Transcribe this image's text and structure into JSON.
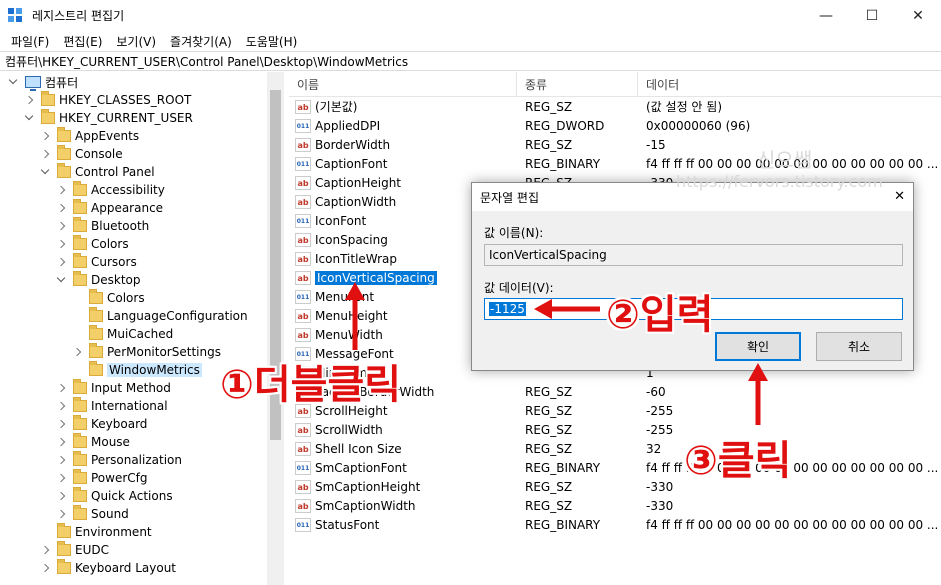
{
  "window": {
    "title": "레지스트리 편집기",
    "controls": {
      "minimize": "—",
      "maximize": "☐",
      "close": "✕"
    }
  },
  "menu": [
    "파일(F)",
    "편집(E)",
    "보기(V)",
    "즐겨찾기(A)",
    "도움말(H)"
  ],
  "address": "컴퓨터\\HKEY_CURRENT_USER\\Control Panel\\Desktop\\WindowMetrics",
  "tree": {
    "computer": "컴퓨터",
    "items": [
      "HKEY_CLASSES_ROOT",
      "HKEY_CURRENT_USER",
      "AppEvents",
      "Console",
      "Control Panel",
      "Accessibility",
      "Appearance",
      "Bluetooth",
      "Colors",
      "Cursors",
      "Desktop",
      "Colors",
      "LanguageConfiguration",
      "MuiCached",
      "PerMonitorSettings",
      "WindowMetrics",
      "Input Method",
      "International",
      "Keyboard",
      "Mouse",
      "Personalization",
      "PowerCfg",
      "Quick Actions",
      "Sound",
      "Environment",
      "EUDC",
      "Keyboard Layout"
    ]
  },
  "list": {
    "columns": [
      "이름",
      "종류",
      "데이터"
    ],
    "rows": [
      {
        "name": "(기본값)",
        "type": "REG_SZ",
        "data": "(값 설정 안 됨)",
        "icon": "ab"
      },
      {
        "name": "AppliedDPI",
        "type": "REG_DWORD",
        "data": "0x00000060 (96)",
        "icon": "bin"
      },
      {
        "name": "BorderWidth",
        "type": "REG_SZ",
        "data": "-15",
        "icon": "ab"
      },
      {
        "name": "CaptionFont",
        "type": "REG_BINARY",
        "data": "f4 ff ff ff 00 00 00 00 00 00 00 00 00 00 00 00 ...",
        "icon": "bin"
      },
      {
        "name": "CaptionHeight",
        "type": "REG_SZ",
        "data": "-330",
        "icon": "ab"
      },
      {
        "name": "CaptionWidth",
        "type": "",
        "data": "",
        "icon": "ab"
      },
      {
        "name": "IconFont",
        "type": "",
        "data": "",
        "icon": "bin"
      },
      {
        "name": "IconSpacing",
        "type": "",
        "data": "",
        "icon": "ab"
      },
      {
        "name": "IconTitleWrap",
        "type": "",
        "data": "",
        "icon": "ab"
      },
      {
        "name": "IconVerticalSpacing",
        "type": "",
        "data": "",
        "icon": "ab"
      },
      {
        "name": "MenuFont",
        "type": "",
        "data": "",
        "icon": "bin"
      },
      {
        "name": "MenuHeight",
        "type": "",
        "data": "",
        "icon": "ab"
      },
      {
        "name": "MenuWidth",
        "type": "",
        "data": "",
        "icon": "ab"
      },
      {
        "name": "MessageFont",
        "type": "",
        "data": "",
        "icon": "bin"
      },
      {
        "name": "MinAnimate",
        "type": "",
        "data": "1",
        "icon": "ab"
      },
      {
        "name": "PaddedBorderWidth",
        "type": "REG_SZ",
        "data": "-60",
        "icon": "ab"
      },
      {
        "name": "ScrollHeight",
        "type": "REG_SZ",
        "data": "-255",
        "icon": "ab"
      },
      {
        "name": "ScrollWidth",
        "type": "REG_SZ",
        "data": "-255",
        "icon": "ab"
      },
      {
        "name": "Shell Icon Size",
        "type": "REG_SZ",
        "data": "32",
        "icon": "ab"
      },
      {
        "name": "SmCaptionFont",
        "type": "REG_BINARY",
        "data": "f4 ff ff ff 00 00 00 00 00 00 00 00 00 00 00 00 ...",
        "icon": "bin"
      },
      {
        "name": "SmCaptionHeight",
        "type": "REG_SZ",
        "data": "-330",
        "icon": "ab"
      },
      {
        "name": "SmCaptionWidth",
        "type": "REG_SZ",
        "data": "-330",
        "icon": "ab"
      },
      {
        "name": "StatusFont",
        "type": "REG_BINARY",
        "data": "f4 ff ff ff 00 00 00 00 00 00 00 00 00 00 00 00 ...",
        "icon": "bin"
      }
    ]
  },
  "dialog": {
    "title": "문자열 편집",
    "name_label": "값 이름(N):",
    "name_value": "IconVerticalSpacing",
    "data_label": "값 데이터(V):",
    "data_value": "-1125",
    "ok": "확인",
    "cancel": "취소",
    "close": "✕"
  },
  "annotations": {
    "step1": "①더블클릭",
    "step2": "②입력",
    "step3": "③클릭",
    "color": "#e01010"
  },
  "watermark": {
    "line1": "신으쌤",
    "line2": "https://fervors.tistory.com"
  },
  "colors": {
    "selection": "#0078d7",
    "tree_selection": "#cce8ff"
  }
}
